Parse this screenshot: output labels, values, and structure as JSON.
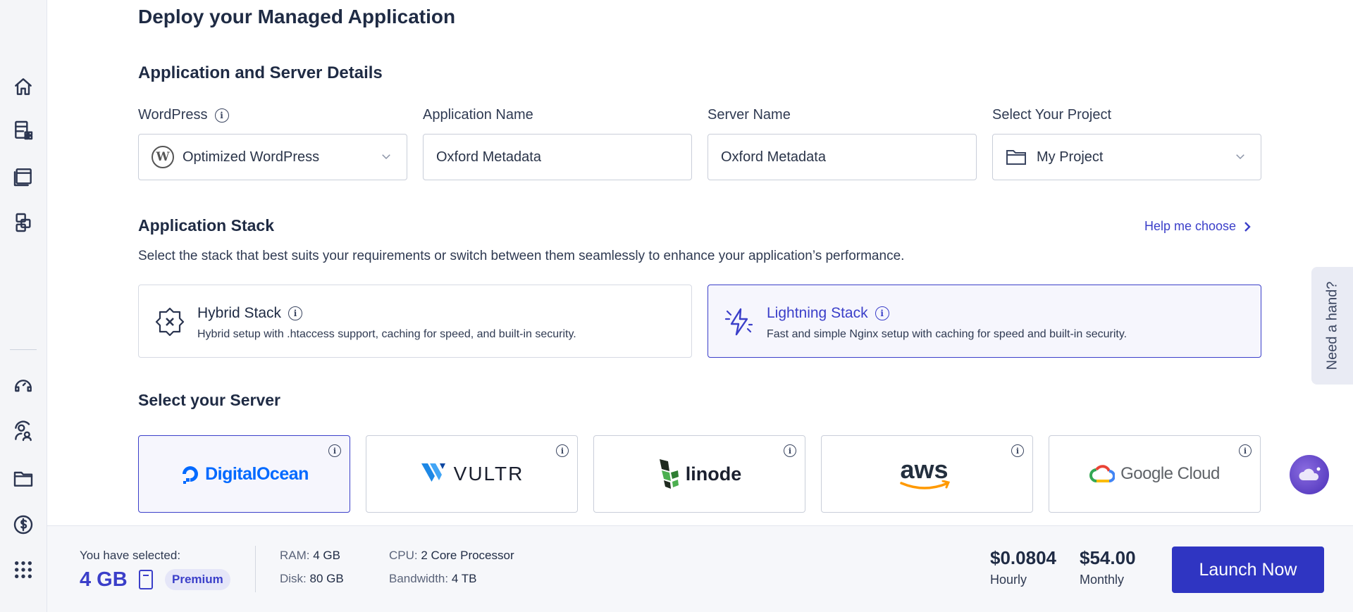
{
  "page": {
    "title": "Deploy your Managed Application"
  },
  "details": {
    "section_title": "Application and Server Details",
    "wordpress_label": "WordPress",
    "wordpress_value": "Optimized WordPress",
    "app_name_label": "Application Name",
    "app_name_value": "Oxford Metadata",
    "server_name_label": "Server Name",
    "server_name_value": "Oxford Metadata",
    "project_label": "Select Your Project",
    "project_value": "My Project"
  },
  "stack": {
    "section_title": "Application Stack",
    "help_link": "Help me choose",
    "description": "Select the stack that best suits your requirements or switch between them seamlessly to enhance your application’s performance.",
    "options": [
      {
        "title": "Hybrid Stack",
        "desc": "Hybrid setup with .htaccess support, caching for speed, and built-in security."
      },
      {
        "title": "Lightning Stack",
        "desc": "Fast and simple Nginx setup with caching for speed and built-in security."
      }
    ]
  },
  "servers": {
    "section_title": "Select your Server",
    "providers": [
      {
        "name": "DigitalOcean"
      },
      {
        "name": "VULTR"
      },
      {
        "name": "linode"
      },
      {
        "name": "aws"
      },
      {
        "name": "Google Cloud"
      }
    ]
  },
  "summary": {
    "selected_label": "You have selected:",
    "ram": "4 GB",
    "badge": "Premium",
    "ram_spec_label": "RAM:",
    "ram_spec_value": "4 GB",
    "disk_label": "Disk:",
    "disk_value": "80 GB",
    "cpu_label": "CPU:",
    "cpu_value": "2 Core Processor",
    "bandwidth_label": "Bandwidth:",
    "bandwidth_value": "4 TB",
    "hourly_price": "$0.0804",
    "hourly_label": "Hourly",
    "monthly_price": "$54.00",
    "monthly_label": "Monthly",
    "launch_button": "Launch Now"
  },
  "help_tab": "Need a hand?",
  "colors": {
    "accent": "#3b3fc9",
    "button": "#2f35c2",
    "text": "#1f2b44"
  }
}
